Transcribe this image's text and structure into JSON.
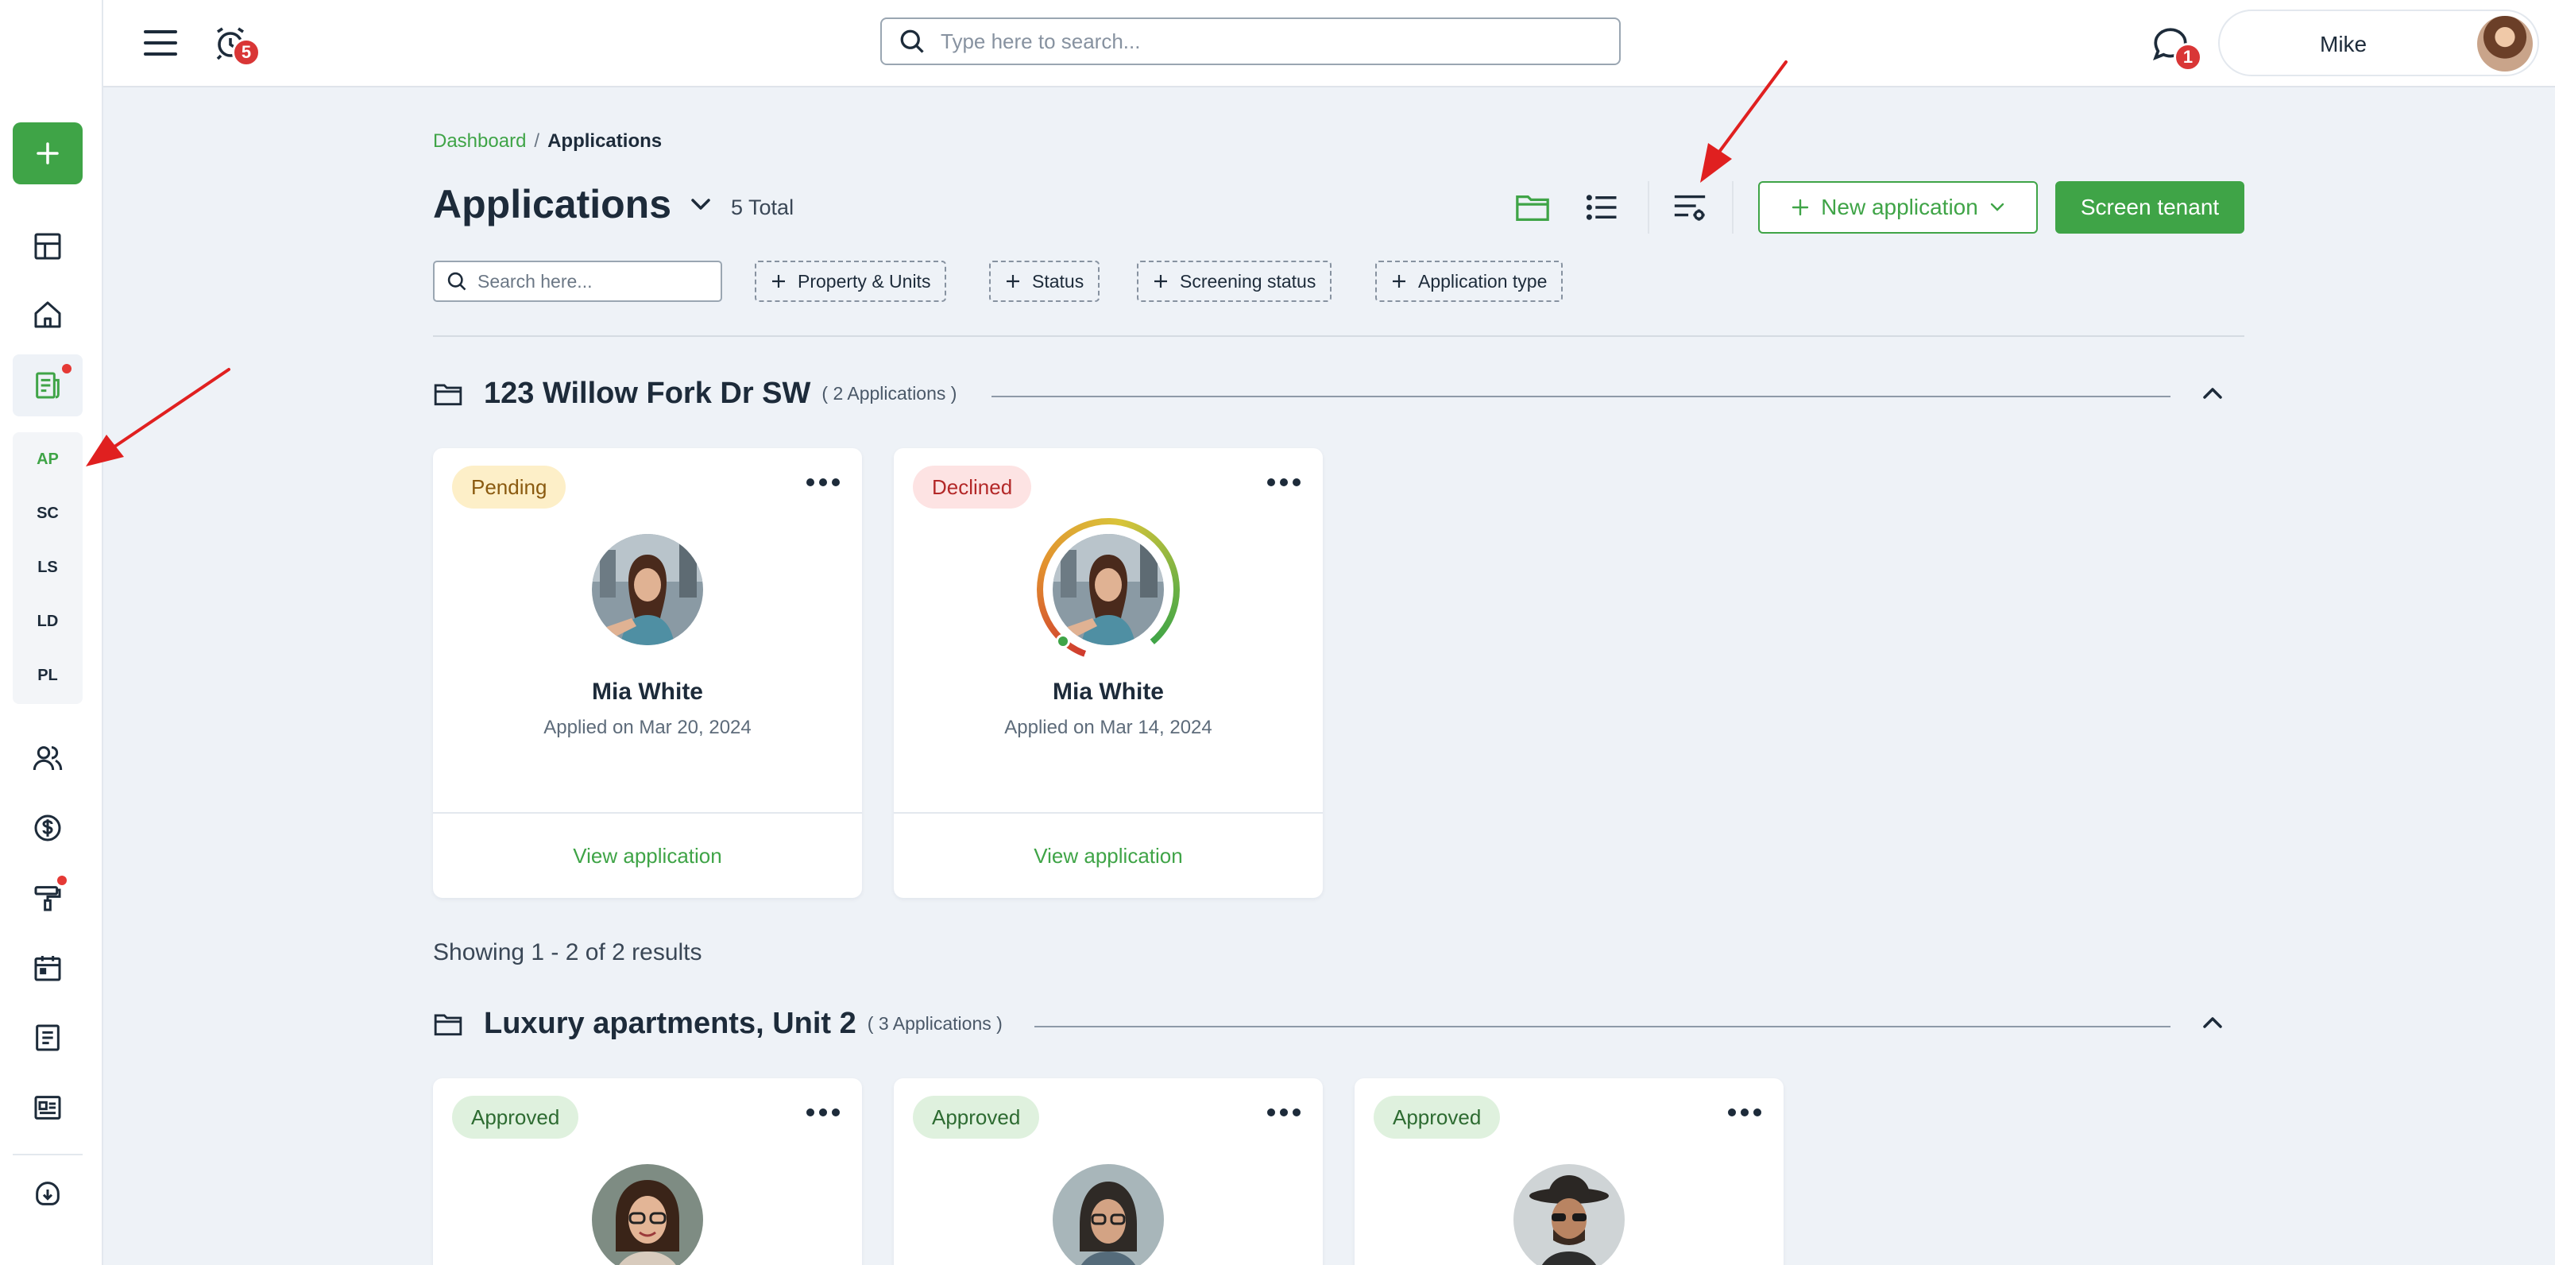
{
  "topbar": {
    "notification_count": "5",
    "search_placeholder": "Type here to search...",
    "messages_count": "1",
    "user_name": "Mike"
  },
  "sidebar": {
    "subnav": [
      "AP",
      "SC",
      "LS",
      "LD",
      "PL"
    ],
    "active_subnav": "AP"
  },
  "breadcrumb": {
    "parent": "Dashboard",
    "separator": "/",
    "current": "Applications"
  },
  "header": {
    "title": "Applications",
    "total": "5 Total",
    "new_application": "New application",
    "screen_tenant": "Screen tenant"
  },
  "filters": {
    "search_placeholder": "Search here...",
    "items": [
      "Property & Units",
      "Status",
      "Screening status",
      "Application type"
    ]
  },
  "groups": [
    {
      "name": "123 Willow Fork Dr SW",
      "count": "( 2 Applications )",
      "cards": [
        {
          "status": "Pending",
          "name": "Mia White",
          "date": "Applied on Mar 20, 2024",
          "link": "View application"
        },
        {
          "status": "Declined",
          "name": "Mia White",
          "date": "Applied on Mar 14, 2024",
          "link": "View application"
        }
      ],
      "showing": "Showing 1 - 2 of 2 results"
    },
    {
      "name": "Luxury apartments, Unit 2",
      "count": "( 3 Applications )",
      "cards": [
        {
          "status": "Approved"
        },
        {
          "status": "Approved"
        },
        {
          "status": "Approved"
        }
      ]
    }
  ],
  "colors": {
    "brand_green": "#3fa447",
    "pending_bg": "#fdefc8",
    "declined_bg": "#fde3e3",
    "approved_bg": "#dff1de",
    "annotation_arrow": "#e02020"
  }
}
